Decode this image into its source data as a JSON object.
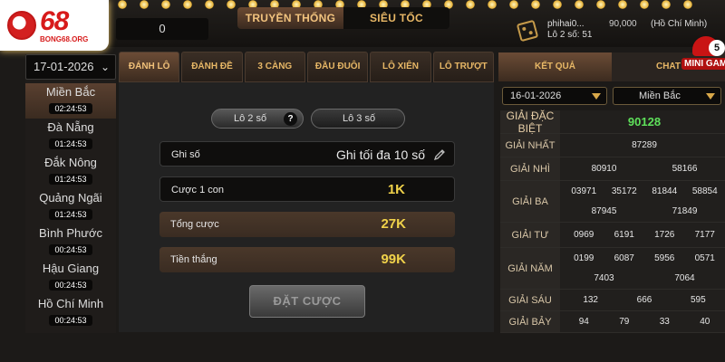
{
  "logo": {
    "number": "68",
    "site": "BONG68.ORG"
  },
  "header": {
    "balance": "0",
    "modes": [
      "TRUYỀN THỐNG",
      "SIÊU TỐC"
    ],
    "user": {
      "name": "phihai0...",
      "money": "90,000",
      "city": "(Hồ Chí Minh)",
      "lo_count": "Lô 2 số: 51"
    }
  },
  "minigame": {
    "badge": "5",
    "label": "MINI GAME"
  },
  "sidebar": {
    "date": "17-01-2026",
    "provinces": [
      {
        "name": "Miền Bắc",
        "time": "02:24:53",
        "active": true
      },
      {
        "name": "Đà Nẵng",
        "time": "01:24:53"
      },
      {
        "name": "Đắk Nông",
        "time": "01:24:53"
      },
      {
        "name": "Quảng Ngãi",
        "time": "01:24:53"
      },
      {
        "name": "Bình Phước",
        "time": "00:24:53"
      },
      {
        "name": "Hậu Giang",
        "time": "00:24:53"
      },
      {
        "name": "Hồ Chí Minh",
        "time": "00:24:53"
      }
    ]
  },
  "tabs": [
    "ĐÁNH LÔ",
    "ĐÁNH ĐỀ",
    "3 CÀNG",
    "ĐẦU ĐUÔI",
    "LÔ XIÊN",
    "LÔ TRƯỢT"
  ],
  "subtabs": {
    "lo2": "Lô 2 số",
    "lo3": "Lô 3 số",
    "help": "?"
  },
  "form": {
    "ghi_so": {
      "label": "Ghi số",
      "placeholder": "Ghi tối đa 10 số"
    },
    "cuoc": {
      "label": "Cược 1 con",
      "value": "1K"
    },
    "tong": {
      "label": "Tổng cược",
      "value": "27K"
    },
    "thang": {
      "label": "Tiền thắng",
      "value": "99K"
    },
    "submit": "ĐẶT CƯỢC"
  },
  "results": {
    "tabs": [
      "KẾT QUẢ",
      "CHAT"
    ],
    "date": "16-01-2026",
    "region": "Miền Bắc",
    "rows": [
      {
        "id": "special",
        "label": "GIẢI ĐẶC BIỆT",
        "values": [
          "90128"
        ]
      },
      {
        "id": "first",
        "label": "GIẢI NHẤT",
        "values": [
          "87289"
        ]
      },
      {
        "id": "second",
        "label": "GIẢI NHÌ",
        "values": [
          "80910",
          "58166"
        ]
      },
      {
        "id": "third",
        "label": "GIẢI BA",
        "values": [
          "03971",
          "35172",
          "81844",
          "58854",
          "87945",
          "71849"
        ]
      },
      {
        "id": "fourth",
        "label": "GIẢI TƯ",
        "values": [
          "0969",
          "6191",
          "1726",
          "7177"
        ]
      },
      {
        "id": "fifth",
        "label": "GIẢI NĂM",
        "values": [
          "0199",
          "6087",
          "5956",
          "0571",
          "7403",
          "7064"
        ]
      },
      {
        "id": "sixth",
        "label": "GIẢI SÁU",
        "values": [
          "132",
          "666",
          "595"
        ]
      },
      {
        "id": "seventh",
        "label": "GIẢI BẢY",
        "values": [
          "94",
          "79",
          "33",
          "40"
        ]
      }
    ]
  },
  "colors": {
    "accent": "#e7b766",
    "value": "#f0d24a",
    "special": "#5ee05a",
    "brand": "#d71a1a"
  }
}
